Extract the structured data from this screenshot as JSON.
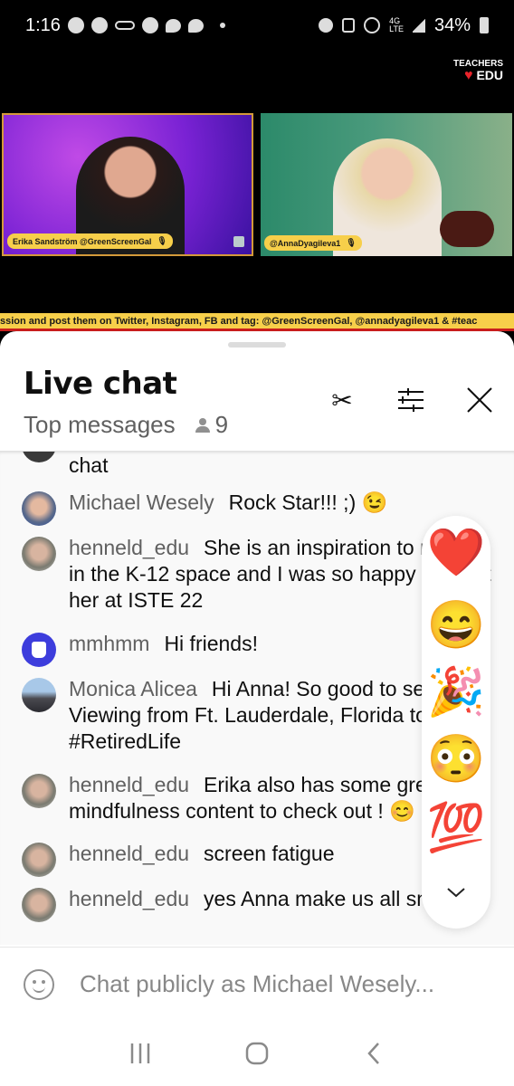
{
  "status_bar": {
    "time": "1:16",
    "battery": "34%",
    "left_icons": [
      "chrome-icon",
      "messenger-icon",
      "voicemail-icon",
      "messenger-icon",
      "chat-bubble-icon",
      "chat-bubble-icon",
      "dot-icon"
    ],
    "right_icons": [
      "alarm-icon",
      "mute-icon",
      "hotspot-icon",
      "4g-lte-icon",
      "signal-icon",
      "battery-icon"
    ]
  },
  "video": {
    "brand_top": "TEACHERS",
    "brand_bottom": "EDU",
    "left_cam_name": "Erika Sandström @GreenScreenGal",
    "right_cam_name": "@AnnaDyagileva1",
    "ticker": "ssion and post them on Twitter, Instagram, FB and tag: @GreenScreenGal, @annadyagileva1 & #teac",
    "colors": {
      "ticker_bg": "#f7cf4a",
      "ticker_line": "#c81d1d",
      "frame": "#d49a3a"
    }
  },
  "chat": {
    "title": "Live chat",
    "mode": "Top messages",
    "viewer_count": "9",
    "partial_message": "chat",
    "messages": [
      {
        "author": "Michael Wesely",
        "text": "Rock Star!!! ;) 😉"
      },
      {
        "author": "henneld_edu",
        "text": "She is an inspiration to many in the K-12 space and I was so happy to meet her at ISTE 22"
      },
      {
        "author": "mmhmm",
        "text": "Hi friends!"
      },
      {
        "author": "Monica Alicea",
        "text": "Hi Anna! So good to see you! Viewing from Ft. Lauderdale, Florida today. #RetiredLife"
      },
      {
        "author": "henneld_edu",
        "text": "Erika also has some great mindfulness content to check out ! 😊"
      },
      {
        "author": "henneld_edu",
        "text": "screen fatigue"
      },
      {
        "author": "henneld_edu",
        "text": "yes Anna make us all smile big"
      }
    ],
    "reactions": [
      "❤️",
      "😄",
      "🎉",
      "😳",
      "💯"
    ],
    "input_placeholder": "Chat publicly as Michael Wesely..."
  },
  "nav": {
    "recents": "recents-icon",
    "home": "home-icon",
    "back": "back-icon"
  }
}
